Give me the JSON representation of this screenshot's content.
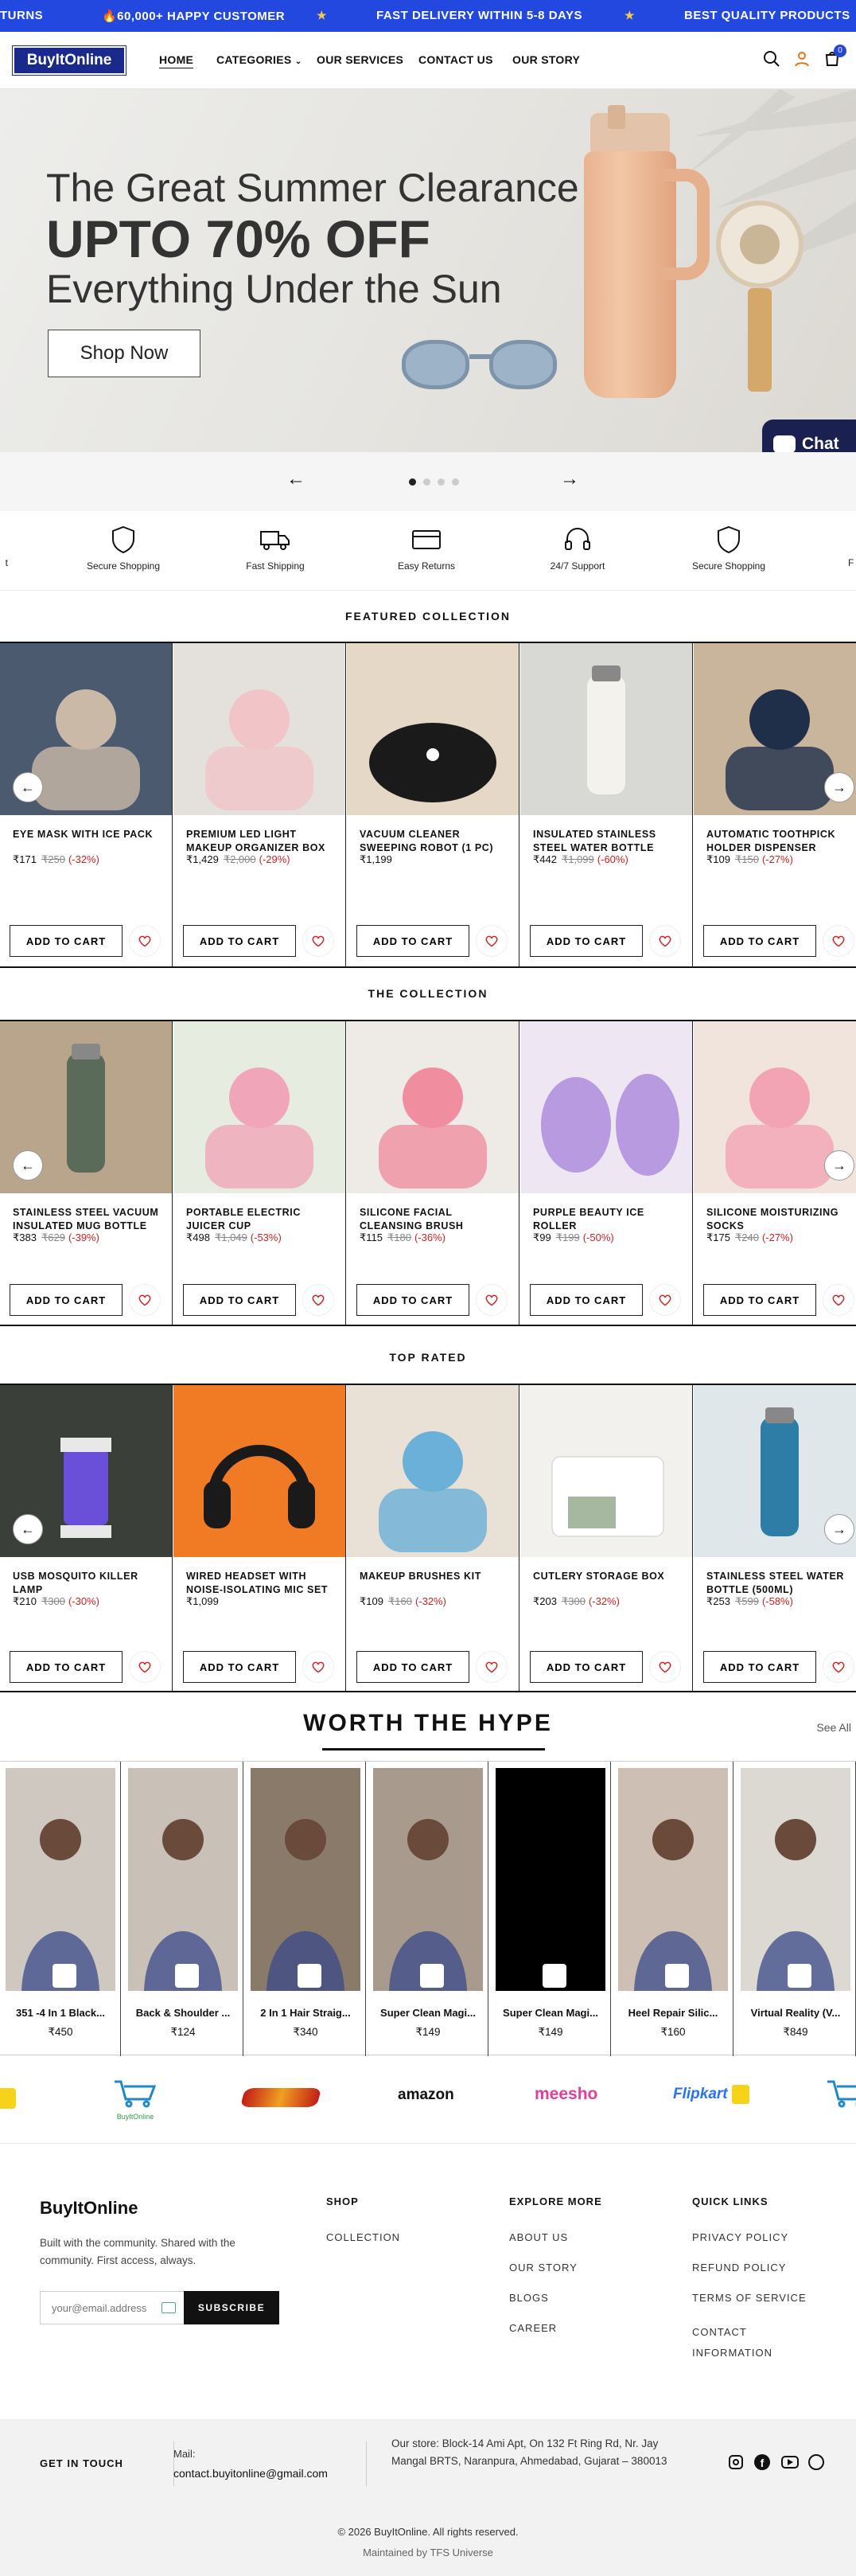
{
  "announcement": {
    "items": [
      "TURNS",
      "🔥60,000+ HAPPY CUSTOMER",
      "FAST DELIVERY WITHIN 5-8 DAYS",
      "BEST QUALITY PRODUCTS"
    ],
    "separator": "★"
  },
  "header": {
    "logo": "BuyItOnline",
    "nav": [
      "HOME",
      "CATEGORIES",
      "OUR SERVICES",
      "CONTACT US",
      "OUR STORY"
    ],
    "cart_count": "0",
    "icons": [
      "search-icon",
      "user-icon",
      "cart-icon"
    ]
  },
  "hero": {
    "line1": "The Great Summer Clearance",
    "line2": "UPTO 70% OFF",
    "line3": "Everything Under the Sun",
    "cta": "Shop Now",
    "chat": "Chat"
  },
  "slider": {
    "prev": "←",
    "next": "→",
    "dots": 4,
    "active_dot": 0
  },
  "features": [
    {
      "label": "Secure Shopping",
      "icon": "shield-icon"
    },
    {
      "label": "Fast Shipping",
      "icon": "truck-icon"
    },
    {
      "label": "Easy Returns",
      "icon": "card-icon"
    },
    {
      "label": "24/7 Support",
      "icon": "headset-icon"
    },
    {
      "label": "Secure Shopping",
      "icon": "shield-icon"
    }
  ],
  "add_to_cart": "ADD TO CART",
  "sections": [
    {
      "title": "FEATURED COLLECTION",
      "products": [
        {
          "name": "EYE MASK WITH ICE PACK",
          "price": "₹171",
          "old": "₹250",
          "off": "(-32%)"
        },
        {
          "name": "PREMIUM LED LIGHT MAKEUP ORGANIZER BOX",
          "price": "₹1,429",
          "old": "₹2,000",
          "off": "(-29%)"
        },
        {
          "name": "VACUUM CLEANER SWEEPING ROBOT (1 PC)",
          "price": "₹1,199",
          "old": "",
          "off": ""
        },
        {
          "name": "INSULATED STAINLESS STEEL WATER BOTTLE",
          "price": "₹442",
          "old": "₹1,099",
          "off": "(-60%)"
        },
        {
          "name": "AUTOMATIC TOOTHPICK HOLDER DISPENSER",
          "price": "₹109",
          "old": "₹150",
          "off": "(-27%)"
        }
      ]
    },
    {
      "title": "THE COLLECTION",
      "products": [
        {
          "name": "STAINLESS STEEL VACUUM INSULATED MUG BOTTLE",
          "price": "₹383",
          "old": "₹629",
          "off": "(-39%)"
        },
        {
          "name": "PORTABLE ELECTRIC JUICER CUP",
          "price": "₹498",
          "old": "₹1,049",
          "off": "(-53%)"
        },
        {
          "name": "SILICONE FACIAL CLEANSING BRUSH",
          "price": "₹115",
          "old": "₹180",
          "off": "(-36%)"
        },
        {
          "name": "PURPLE BEAUTY ICE ROLLER",
          "price": "₹99",
          "old": "₹199",
          "off": "(-50%)"
        },
        {
          "name": "SILICONE MOISTURIZING SOCKS",
          "price": "₹175",
          "old": "₹240",
          "off": "(-27%)"
        }
      ]
    },
    {
      "title": "TOP RATED",
      "products": [
        {
          "name": "USB MOSQUITO KILLER LAMP",
          "price": "₹210",
          "old": "₹300",
          "off": "(-30%)"
        },
        {
          "name": "WIRED HEADSET WITH NOISE-ISOLATING MIC SET",
          "price": "₹1,099",
          "old": "",
          "off": ""
        },
        {
          "name": "MAKEUP BRUSHES KIT",
          "price": "₹109",
          "old": "₹160",
          "off": "(-32%)"
        },
        {
          "name": "CUTLERY STORAGE BOX",
          "price": "₹203",
          "old": "₹300",
          "off": "(-32%)"
        },
        {
          "name": "STAINLESS STEEL WATER BOTTLE (500ML)",
          "price": "₹253",
          "old": "₹599",
          "off": "(-58%)"
        }
      ]
    }
  ],
  "hype": {
    "title": "WORTH THE HYPE",
    "see_all": "See All",
    "items": [
      {
        "title": "351 -4 In 1 Black...",
        "price": "₹450"
      },
      {
        "title": "Back & Shoulder ...",
        "price": "₹124"
      },
      {
        "title": "2 In 1 Hair Straig...",
        "price": "₹340"
      },
      {
        "title": "Super Clean Magi...",
        "price": "₹149"
      },
      {
        "title": "Super Clean Magi...",
        "price": "₹149"
      },
      {
        "title": "Heel Repair Silic...",
        "price": "₹160"
      },
      {
        "title": "Virtual Reality (V...",
        "price": "₹849"
      }
    ]
  },
  "marketplaces": [
    "BuyItOnline",
    "amazon",
    "meesho",
    "Flipkart"
  ],
  "footer": {
    "brand": "BuyItOnline",
    "tagline": "Built with the community. Shared with the community. First access, always.",
    "email_placeholder": "your@email.address",
    "subscribe": "SUBSCRIBE",
    "shop_title": "SHOP",
    "shop_links": [
      "COLLECTION"
    ],
    "explore_title": "EXPLORE MORE",
    "explore_links": [
      "ABOUT US",
      "OUR STORY",
      "BLOGS",
      "CAREER"
    ],
    "quick_title": "QUICK LINKS",
    "quick_links": [
      "PRIVACY POLICY",
      "REFUND POLICY",
      "TERMS OF SERVICE",
      "CONTACT INFORMATION"
    ]
  },
  "contact": {
    "title": "GET IN TOUCH",
    "mail_label": "Mail:",
    "mail": "contact.buyitonline@gmail.com",
    "address": "Our store: Block-14 Ami Apt, On 132 Ft Ring Rd, Nr. Jay Mangal BRTS, Naranpura, Ahmedabad, Gujarat – 380013",
    "socials": [
      "instagram-icon",
      "facebook-icon",
      "youtube-icon",
      "whatsapp-icon"
    ]
  },
  "copyright": "© 2026 BuyItOnline. All rights reserved.",
  "maintained_prefix": "Maintained by",
  "maintained_by": "TFS Universe"
}
